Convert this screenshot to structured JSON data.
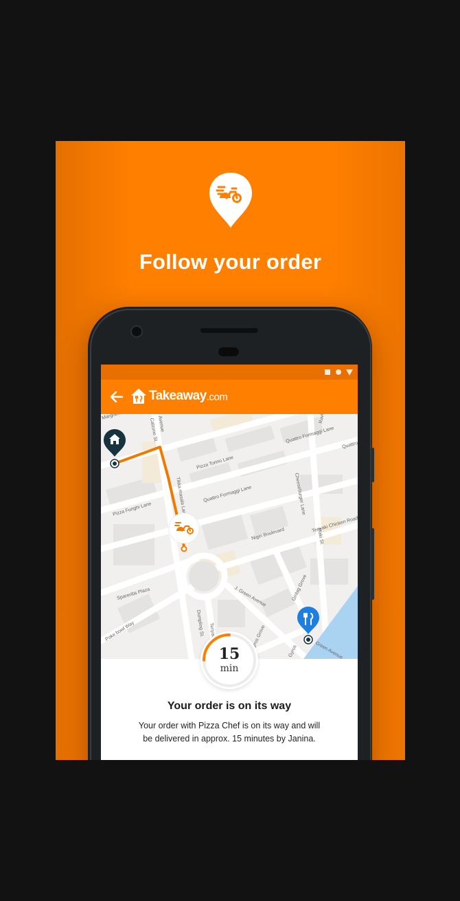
{
  "banner": {
    "headline": "Follow your order",
    "background_color": "#ff8000",
    "icon": "delivery-bike-pin-icon"
  },
  "app": {
    "brand_name": "Takeaway",
    "brand_tld": ".com",
    "back_icon": "arrow-left-icon",
    "brand_icon": "takeaway-house-logo-icon",
    "accent_color": "#ff8000"
  },
  "status_bar": {
    "icons": [
      "square-icon",
      "circle-icon",
      "triangle-icon"
    ]
  },
  "map": {
    "streets": {
      "s1": "Margherita St.",
      "s2": "Calzone St.",
      "s3": "Avenue",
      "s4": "Pizza Tonno Lane",
      "s5": "Quattro Formaggi Lane",
      "s6": "Quattro Formaggi Lane",
      "s7": "Quattro",
      "s8": "Ravioli Hummus",
      "s9": "Tikka masala Lane",
      "s10": "Cheeseburger Lane",
      "s11": "Pizza Funghi Lane",
      "s12": "Teriyaki Chicken Road",
      "s13": "Nigiri Boulevard",
      "s14": "Maki St.",
      "s15": "Spareribs Plaza",
      "s16": "J. Green Avenue",
      "s17": "Ginbig Grove",
      "s18": "Poke bowl Way",
      "s19": "Dumpling St.",
      "s20": "Teriyaki",
      "s21": "Gyros Grove",
      "s22": "Green Avenue",
      "s23": "Gyros"
    },
    "home_pin_icon": "home-pin-icon",
    "courier_icon": "courier-bike-icon",
    "restaurant_pin_icon": "restaurant-pin-icon",
    "route_color": "#f07a00",
    "water_color": "#aad3f2"
  },
  "order": {
    "eta_number": "15",
    "eta_unit": "min",
    "eta_progress": 0.25,
    "title": "Your order is on its way",
    "message": "Your order with Pizza Chef is on its way and will be delivered in approx. 15 minutes by Janina."
  }
}
